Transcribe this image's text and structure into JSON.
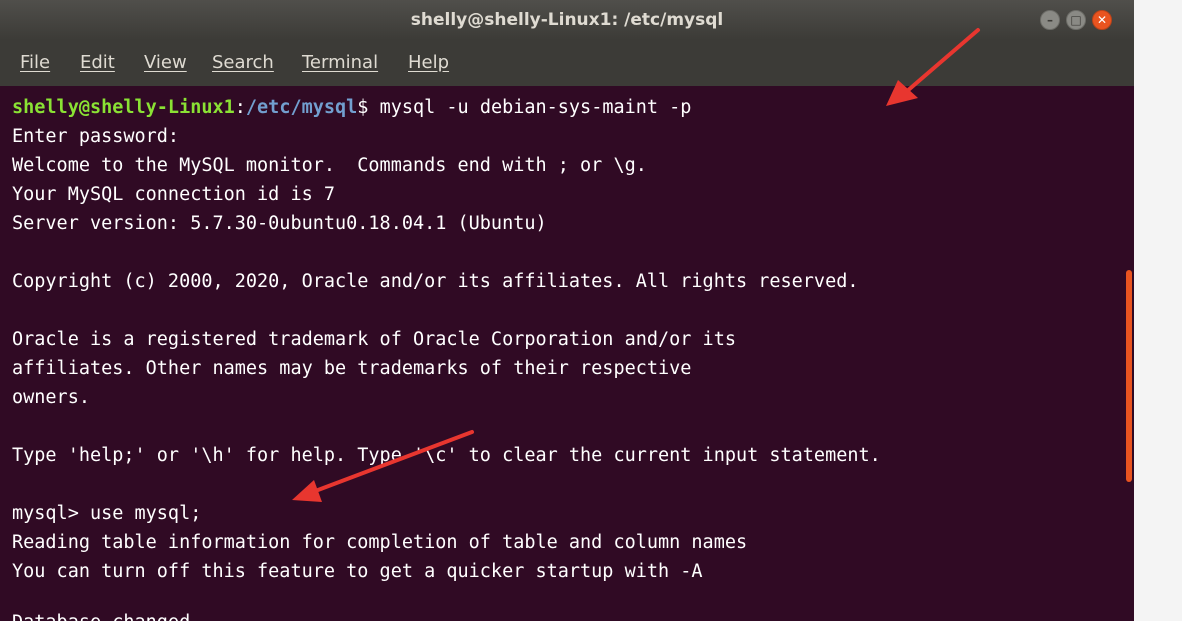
{
  "window": {
    "title": "shelly@shelly-Linux1: /etc/mysql",
    "buttons": {
      "minimize": "–",
      "maximize": "□",
      "close": "✕"
    }
  },
  "menu": [
    "File",
    "Edit",
    "View",
    "Search",
    "Terminal",
    "Help"
  ],
  "prompt": {
    "user_host": "shelly@shelly-Linux1",
    "sep": ":",
    "path": "/etc/mysql",
    "symbol": "$",
    "command": " mysql -u debian-sys-maint -p"
  },
  "lines": [
    "Enter password:",
    "Welcome to the MySQL monitor.  Commands end with ; or \\g.",
    "Your MySQL connection id is 7",
    "Server version: 5.7.30-0ubuntu0.18.04.1 (Ubuntu)",
    "",
    "Copyright (c) 2000, 2020, Oracle and/or its affiliates. All rights reserved.",
    "",
    "Oracle is a registered trademark of Oracle Corporation and/or its",
    "affiliates. Other names may be trademarks of their respective",
    "owners.",
    "",
    "Type 'help;' or '\\h' for help. Type '\\c' to clear the current input statement.",
    "",
    "mysql> use mysql;",
    "Reading table information for completion of table and column names",
    "You can turn off this feature to get a quicker startup with -A",
    "",
    "Database changed"
  ],
  "colors": {
    "terminal_bg": "#300a24",
    "prompt_user": "#8ae234",
    "prompt_path": "#729fcf",
    "accent": "#e95420",
    "annotation_arrow": "#e8362f"
  }
}
